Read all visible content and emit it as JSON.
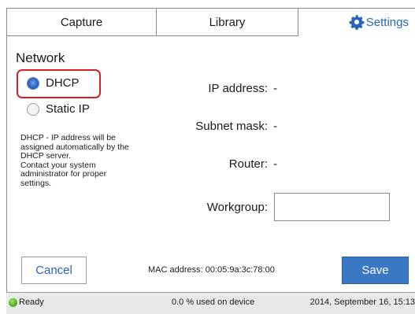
{
  "tabs": {
    "capture": "Capture",
    "library": "Library",
    "settings": "Settings"
  },
  "network": {
    "heading": "Network",
    "options": {
      "dhcp": "DHCP",
      "static": "Static IP"
    },
    "selected": "DHCP",
    "help_lines": [
      "DHCP - IP address will be",
      "assigned automatically by the",
      "DHCP server.",
      "Contact your system",
      "administrator for proper",
      "settings."
    ],
    "fields": {
      "ip_label": "IP address:",
      "ip_value": "-",
      "subnet_label": "Subnet mask:",
      "subnet_value": "-",
      "router_label": "Router:",
      "router_value": "-",
      "workgroup_label": "Workgroup:",
      "workgroup_value": ""
    }
  },
  "footer": {
    "cancel": "Cancel",
    "save": "Save",
    "mac": "MAC address: 00:05:9a:3c:78:00"
  },
  "status": {
    "ready": "Ready",
    "usage": "0.0 % used on device",
    "datetime": "2014, September 16, 15:13"
  },
  "colors": {
    "accent": "#2a64b8",
    "save_button": "#3b78c4",
    "highlight": "#d31f26",
    "ready_dot": "#4fae1e"
  },
  "icons": {
    "settings": "gear-icon",
    "ready": "status-dot-icon"
  }
}
